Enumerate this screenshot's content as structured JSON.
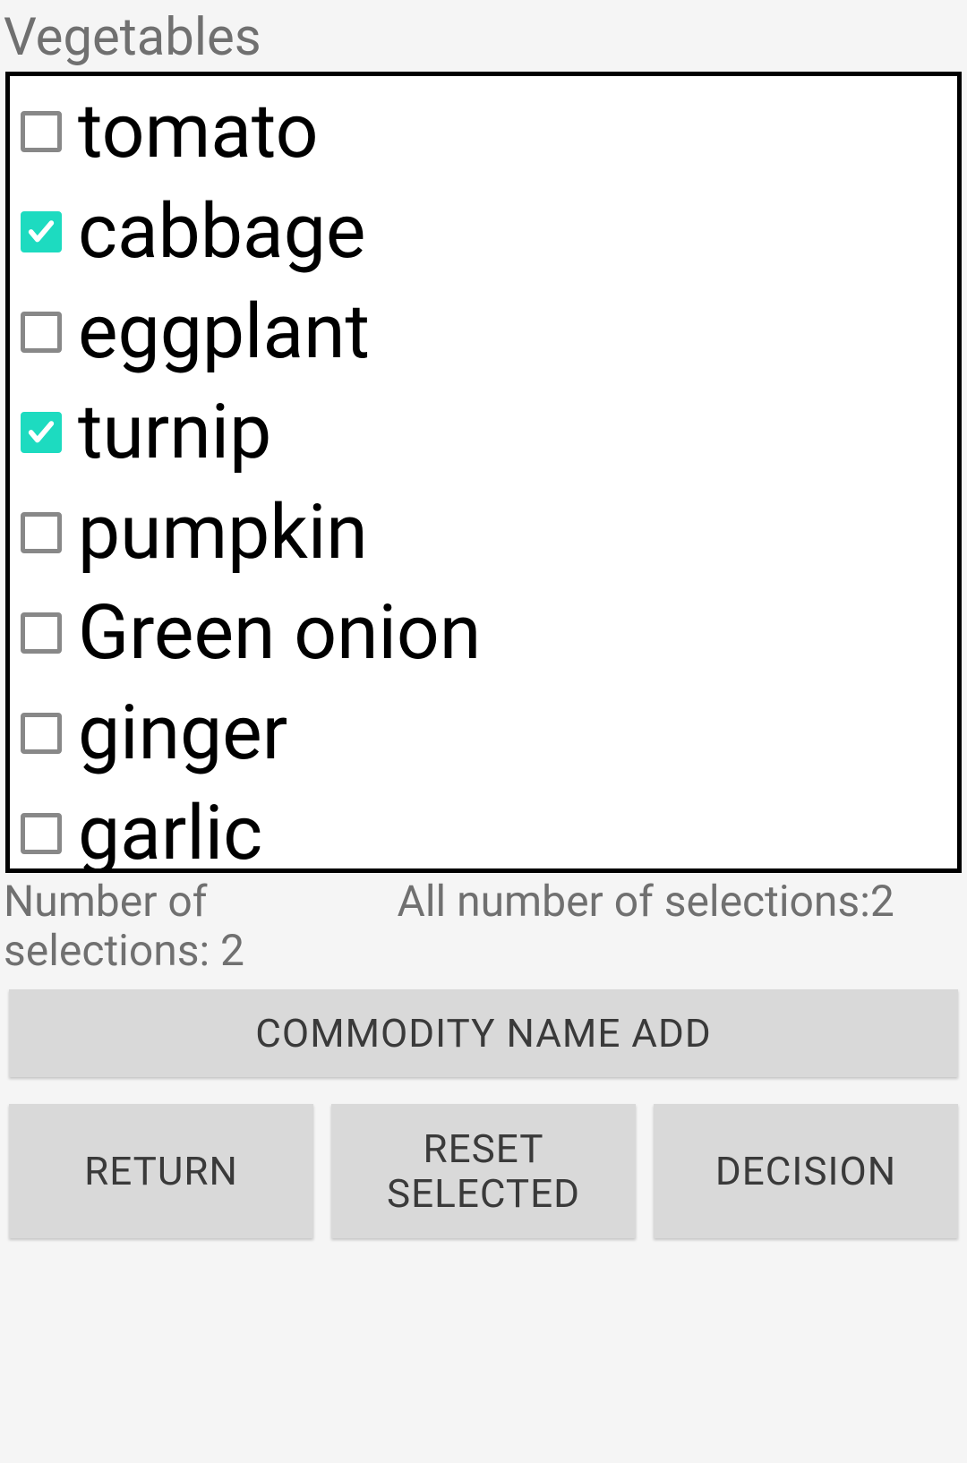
{
  "header": {
    "title": "Vegetables"
  },
  "items": [
    {
      "label": "tomato",
      "checked": false
    },
    {
      "label": "cabbage",
      "checked": true
    },
    {
      "label": "eggplant",
      "checked": false
    },
    {
      "label": "turnip",
      "checked": true
    },
    {
      "label": "pumpkin",
      "checked": false
    },
    {
      "label": "Green onion",
      "checked": false
    },
    {
      "label": "ginger",
      "checked": false
    },
    {
      "label": "garlic",
      "checked": false
    }
  ],
  "stats": {
    "selections_label": "Number of selections: 2",
    "all_selections_label": "All number of selections:2"
  },
  "buttons": {
    "add": "COMMODITY NAME ADD",
    "return": "RETURN",
    "reset": "RESET SELECTED",
    "decision": "DECISION"
  },
  "colors": {
    "accent": "#1ddbc0",
    "button_bg": "#d9d9d9",
    "text_muted": "#707070"
  }
}
